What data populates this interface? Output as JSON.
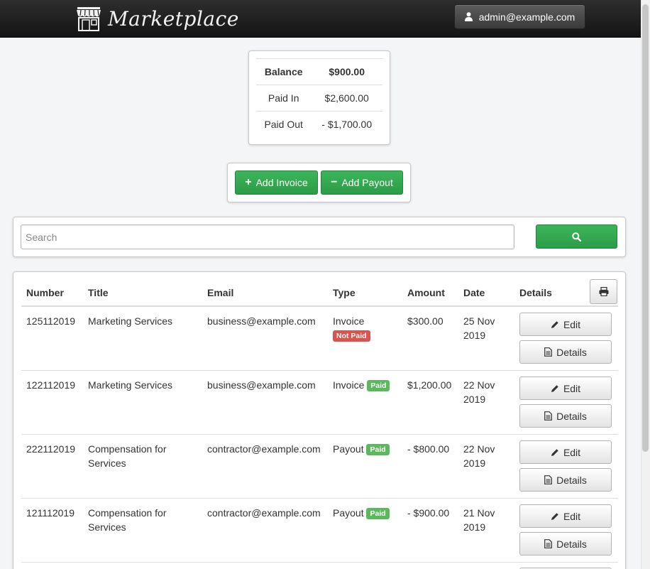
{
  "navbar": {
    "brand_name": "Marketplace",
    "user_email": "admin@example.com"
  },
  "balance": {
    "rows": [
      {
        "label": "Balance",
        "value": "$900.00"
      },
      {
        "label": "Paid In",
        "value": "$2,600.00"
      },
      {
        "label": "Paid Out",
        "value": "- $1,700.00"
      }
    ]
  },
  "actions": {
    "add_invoice_label": "Add Invoice",
    "add_payout_label": "Add Payout"
  },
  "search": {
    "placeholder": "Search",
    "value": ""
  },
  "table": {
    "headers": {
      "number": "Number",
      "title": "Title",
      "email": "Email",
      "type": "Type",
      "amount": "Amount",
      "date": "Date",
      "details": "Details"
    },
    "edit_label": "Edit",
    "details_label": "Details",
    "rows": [
      {
        "number": "125112019",
        "title": "Marketing Services",
        "email": "business@example.com",
        "type": "Invoice",
        "status": "Not Paid",
        "amount": "$300.00",
        "date": "25 Nov 2019"
      },
      {
        "number": "122112019",
        "title": "Marketing Services",
        "email": "business@example.com",
        "type": "Invoice",
        "status": "Paid",
        "amount": "$1,200.00",
        "date": "22 Nov 2019"
      },
      {
        "number": "222112019",
        "title": "Compensation for Services",
        "email": "contractor@example.com",
        "type": "Payout",
        "status": "Paid",
        "amount": "- $800.00",
        "date": "22 Nov 2019"
      },
      {
        "number": "121112019",
        "title": "Compensation for Services",
        "email": "contractor@example.com",
        "type": "Payout",
        "status": "Paid",
        "amount": "- $900.00",
        "date": "21 Nov 2019"
      }
    ]
  },
  "colors": {
    "primary_green": "#2f9e4b",
    "danger_badge": "#d9534f",
    "success_badge": "#5cb85c",
    "navbar_bg": "#1f1f1f"
  },
  "icons": {
    "brand": "storefront-icon",
    "user": "user-icon",
    "add": "plus-icon",
    "remove": "minus-icon",
    "search": "search-icon",
    "print": "print-icon",
    "edit": "pencil-icon",
    "details": "document-icon"
  }
}
